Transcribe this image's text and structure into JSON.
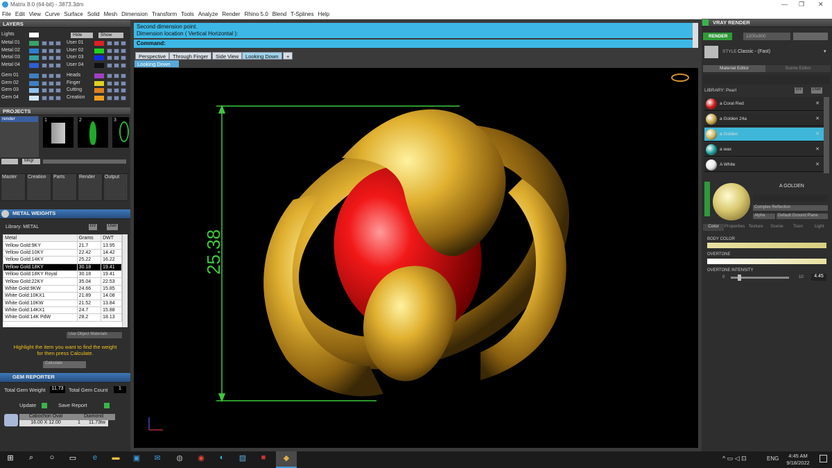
{
  "window": {
    "title": "Matrix 8.0 (64-bit) - 3873.3dm",
    "min": "—",
    "max": "❐",
    "close": "✕"
  },
  "menu": [
    "File",
    "Edit",
    "View",
    "Curve",
    "Surface",
    "Solid",
    "Mesh",
    "Dimension",
    "Transform",
    "Tools",
    "Analyze",
    "Render",
    "Rhino 5.0",
    "Blend",
    "T-Splines",
    "Help"
  ],
  "layers": {
    "title": "LAYERS",
    "lights": "Lights",
    "hide": "Hide",
    "show": "Show",
    "left": [
      {
        "name": "Metal 01",
        "color": "#3aa06a"
      },
      {
        "name": "Metal 02",
        "color": "#2f7fd0"
      },
      {
        "name": "Metal 03",
        "color": "#3aa0a0"
      },
      {
        "name": "Metal 04",
        "color": "#2f5fd0"
      },
      {
        "name": "Gem 01",
        "color": "#3f7fc0"
      },
      {
        "name": "Gem 02",
        "color": "#3f7fc0"
      },
      {
        "name": "Gem 03",
        "color": "#8fc0ef"
      },
      {
        "name": "Gem 04",
        "color": "#cfe6ff"
      }
    ],
    "right": [
      {
        "name": "User 01",
        "color": "#e02020"
      },
      {
        "name": "User 02",
        "color": "#20d020"
      },
      {
        "name": "User 03",
        "color": "#1030e0"
      },
      {
        "name": "User 04",
        "color": "#101010"
      },
      {
        "name": "Heads",
        "color": "#a040c0"
      },
      {
        "name": "Finger",
        "color": "#e0d020"
      },
      {
        "name": "Cutting",
        "color": "#e08020"
      },
      {
        "name": "Creation",
        "color": "#f0a020"
      }
    ]
  },
  "projects": {
    "title": "PROJECTS",
    "item": "render",
    "nums": [
      "1",
      "2",
      "3"
    ],
    "mngr": "Mngr"
  },
  "bottom_tabs": [
    "Master",
    "Creation",
    "Parts",
    "Render",
    "Output"
  ],
  "metal_weights": {
    "title": "METAL WEIGHTS",
    "library": "Library: METAL",
    "gv": "GV",
    "user": "User",
    "columns": [
      "Metal",
      "Grams",
      "DWT"
    ],
    "rows": [
      [
        "Yellow Gold:9KY",
        "21.7",
        "13.95"
      ],
      [
        "Yellow Gold:10KY",
        "22.42",
        "14.42"
      ],
      [
        "Yellow Gold:14KY",
        "25.22",
        "16.22"
      ],
      [
        "Yellow Gold:18KY",
        "30.18",
        "19.41"
      ],
      [
        "Yellow Gold:18KY Royal",
        "30.18",
        "19.41"
      ],
      [
        "Yellow Gold:22KY",
        "35.04",
        "22.53"
      ],
      [
        "White Gold:9KW",
        "24.66",
        "15.85"
      ],
      [
        "White Gold:10KX1",
        "21.89",
        "14.08"
      ],
      [
        "White Gold:10KW",
        "21.52",
        "13.84"
      ],
      [
        "White Gold:14KX1",
        "24.7",
        "15.88"
      ],
      [
        "White Gold:14K PdW",
        "28.2",
        "18.13"
      ]
    ],
    "use_obj": "Use Object Materials",
    "hint1": "Highlight the item you want to find the weight",
    "hint2": "for then press Calculate.",
    "calc": "Calculate"
  },
  "gem_reporter": {
    "title": "GEM REPORTER",
    "tgw_label": "Total Gem Weight",
    "tgw": "11.73",
    "tgc_label": "Total Gem Count",
    "tgc": "1",
    "update": "Update",
    "save": "Save Report",
    "gem_shape": "Cabochon Oval",
    "gem_size": "16.00 X 12.00",
    "gem_type": "Diamond",
    "gem_count": "1",
    "gem_wt": "11.73tw"
  },
  "command": {
    "line1": "Second dimension point.",
    "line2": "Dimension location ( Vertical  Horizontal ):",
    "label": "Command:"
  },
  "viewports": {
    "tabs": [
      "Perspective",
      "Through Finger",
      "Side View",
      "Looking Down"
    ],
    "active": "Looking Down",
    "dimension": "25.38"
  },
  "vray": {
    "title": "VRAY RENDER",
    "render": "RENDER",
    "size": "1200x900",
    "style_label": "STYLE",
    "style": "Classic - (Fast)",
    "mat_editor": "Material Editor",
    "scene_editor": "Scene Editor",
    "library": "LIBRARY: Pearl",
    "gv": "GV",
    "user": "User",
    "materials": [
      {
        "name": "a Coral Red",
        "color": "#d01818"
      },
      {
        "name": "a Golden 24a",
        "color": "#c9a84a"
      },
      {
        "name": "a Golden",
        "color": "#d0b860"
      },
      {
        "name": "a wax",
        "color": "#20a0a0"
      },
      {
        "name": "A White",
        "color": "#e8e8e8"
      }
    ],
    "selected_name": "A GOLDEN",
    "reflection": "Complex Reflection",
    "alpha": "Alpha",
    "ground": "Default Ground Plane",
    "subtabs": [
      "Color",
      "Properties",
      "Texture",
      "Scene",
      "Toon",
      "Light"
    ],
    "body_color": "BODY COLOR",
    "overtone": "OVERTONE",
    "intensity_label": "OVERTONE INTENSITY",
    "int_min": "0",
    "int_max": "10",
    "int_val": "4.45"
  },
  "taskbar": {
    "lang": "ENG",
    "time": "4:45 AM",
    "date": "9/18/2022"
  }
}
